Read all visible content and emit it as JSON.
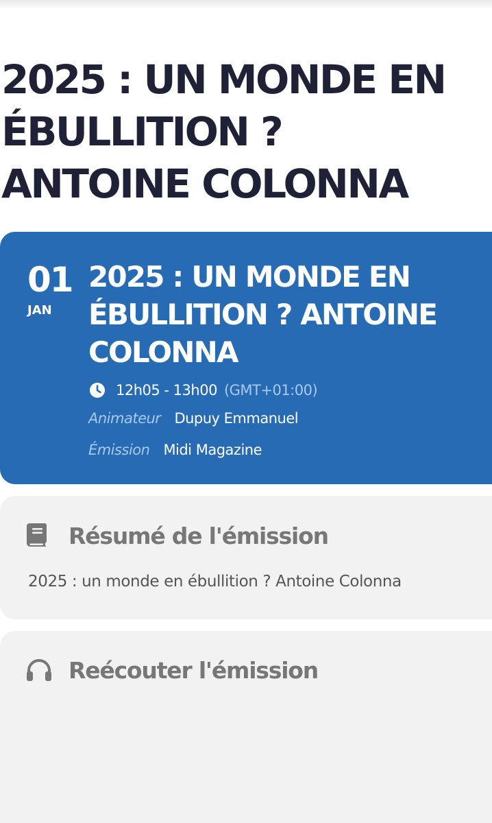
{
  "page": {
    "title": "2025 : UN MONDE EN ÉBULLITION ? ANTOINE COLONNA"
  },
  "event": {
    "day": "01",
    "month": "JAN",
    "title": "2025 : UN MONDE EN ÉBULLITION ? ANTOINE COLONNA",
    "time": "12h05 - 13h00",
    "timezone": "(GMT+01:00)",
    "host_label": "Animateur",
    "host_value": "Dupuy Emmanuel",
    "show_label": "Émission",
    "show_value": "Midi Magazine",
    "clock_icon": "clock-icon"
  },
  "summary": {
    "heading": "Résumé de l'émission",
    "text": "2025 : un monde en ébullition ? Antoine Colonna",
    "icon": "book-icon"
  },
  "replay": {
    "heading": "Reécouter l'émission",
    "icon": "headphones-icon"
  },
  "colors": {
    "accent": "#276bb5",
    "title": "#1f2236",
    "panel": "#f2f2f2",
    "muted": "#777777"
  }
}
